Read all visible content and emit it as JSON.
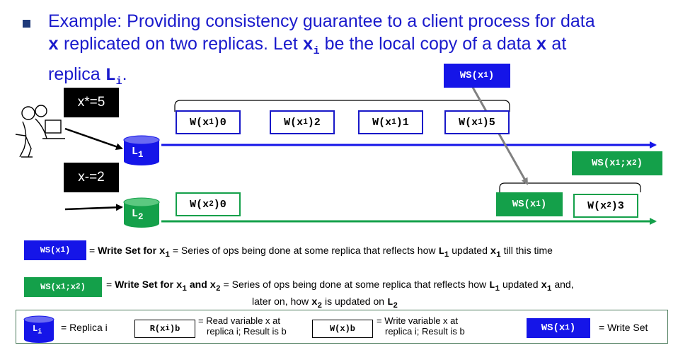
{
  "heading": {
    "line1": "Example: Providing consistency guarantee to a client process for data",
    "line2_var": "x",
    "line2_a": " replicated on two replicas. Let ",
    "line2_var2": "x",
    "line2_sub": "i",
    "line2_b": " be the local copy of a data ",
    "line2_var3": "x",
    "line2_c": " at",
    "line3_a": "replica ",
    "line3_var": "L",
    "line3_sub": "i",
    "line3_b": "."
  },
  "client": {
    "op1": "x*=5",
    "op2": "x-=2"
  },
  "replicas": {
    "r1": {
      "label": "L",
      "sub": "1"
    },
    "r2": {
      "label": "L",
      "sub": "2"
    }
  },
  "timeline1_ops": [
    {
      "pre": "W(x",
      "sub": "1",
      "post": ")0"
    },
    {
      "pre": "W(x",
      "sub": "1",
      "post": ")2"
    },
    {
      "pre": "W(x",
      "sub": "1",
      "post": ")1"
    },
    {
      "pre": "W(x",
      "sub": "1",
      "post": ")5"
    }
  ],
  "timeline2_ops": [
    {
      "pre": "W(x",
      "sub": "2",
      "post": ")0"
    },
    {
      "pre": "W(x",
      "sub": "2",
      "post": ")3"
    }
  ],
  "ws_top": {
    "pre": "WS(x",
    "sub": "1",
    "post": ")"
  },
  "ws_x1x2": {
    "pre": "WS(x",
    "sub": "1",
    "mid": ";x",
    "sub2": "2",
    "post": ")"
  },
  "ws_inline": {
    "pre": "WS(x",
    "sub": "1",
    "post": ")"
  },
  "legend": {
    "ws1_chip": {
      "pre": "WS(x",
      "sub": "1",
      "post": ")"
    },
    "ws1_def": {
      "a": "= ",
      "bold": "Write Set for ",
      "var": "x",
      "sub": "1",
      "b": " = Series of ops being done at some replica that reflects how ",
      "lvar": "L",
      "lsub": "1",
      "c": " updated ",
      "var2": "x",
      "sub2": "1",
      "d": " till this time"
    },
    "ws12_chip": {
      "pre": "WS(x",
      "sub": "1",
      "mid": ";x",
      "sub2": "2",
      "post": ")"
    },
    "ws12_def": {
      "a": "= ",
      "bold": "Write Set for ",
      "var": "x",
      "sub": "1",
      "bold2": " and ",
      "var2": "x",
      "sub2": "2",
      "b": " = Series of ops being done at some replica that reflects how ",
      "lvar": "L",
      "lsub": "1",
      "c": " updated ",
      "var3": "x",
      "sub3": "1",
      "d": " and,",
      "e": "later on, how ",
      "var4": "x",
      "sub4": "2",
      "f": " is updated on ",
      "lvar2": "L",
      "lsub2": "2"
    }
  },
  "key": {
    "replica_label": "L",
    "replica_sub": "i",
    "replica_text": "= Replica i",
    "read_chip": {
      "pre": "R(x",
      "sub": "i",
      "post": ")b"
    },
    "read_text1": "= Read variable x at",
    "read_text2": "replica i;  Result is b",
    "write_chip": "W(x)b",
    "write_text1": "= Write variable x at",
    "write_text2": "replica i;  Result is b",
    "ws_chip": {
      "pre": "WS(x",
      "sub": "1",
      "post": ")"
    },
    "ws_text": "= Write Set"
  },
  "colors": {
    "blue": "#1515e8",
    "green": "#14a04a",
    "heading": "#1a1acc"
  }
}
